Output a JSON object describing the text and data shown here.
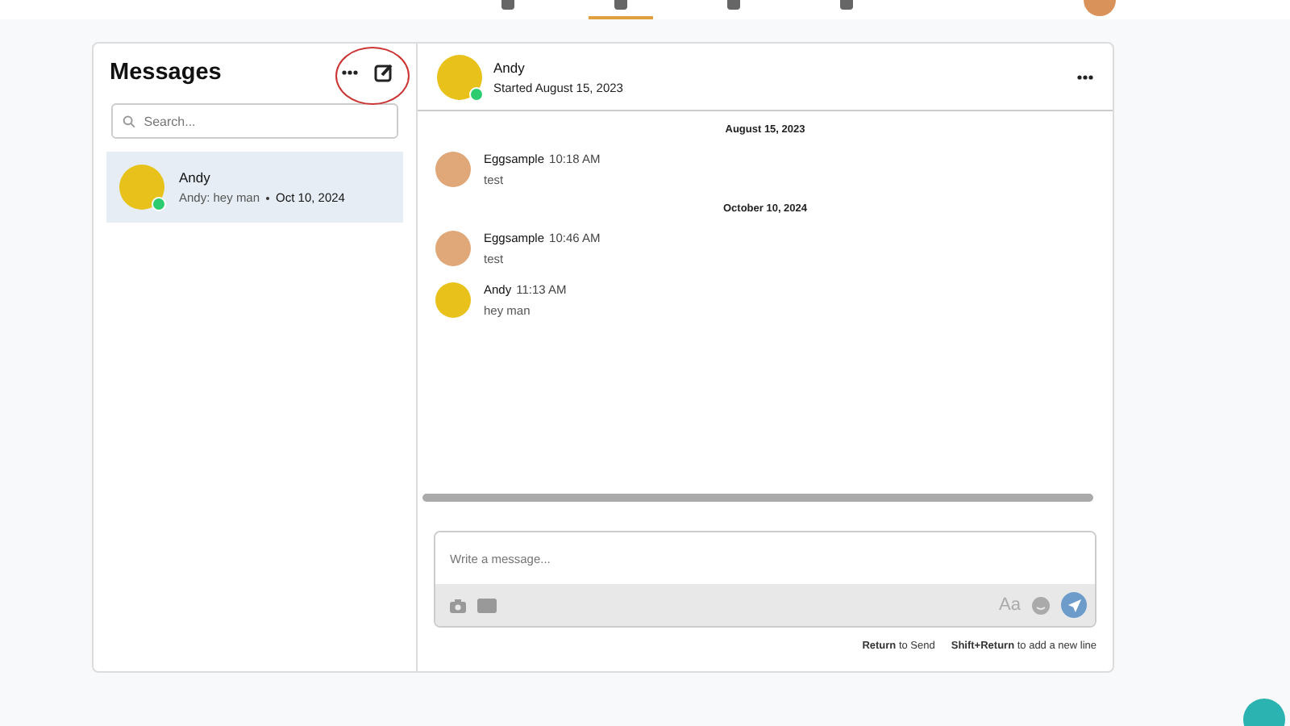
{
  "nav": {
    "tabs": [
      {
        "selected": false
      },
      {
        "selected": true
      },
      {
        "selected": false
      },
      {
        "selected": false
      }
    ]
  },
  "sidebar": {
    "title": "Messages",
    "search": {
      "placeholder": "Search..."
    },
    "conversations": [
      {
        "name": "Andy",
        "preview": "Andy: hey man",
        "date": "Oct 10, 2024",
        "selected": true,
        "online": true
      }
    ]
  },
  "conversation": {
    "name": "Andy",
    "subtitle": "Started August 15, 2023",
    "online": true,
    "items": [
      {
        "kind": "date",
        "text": "August 15, 2023"
      },
      {
        "kind": "message",
        "sender": "Eggsample",
        "color": "#e0a878",
        "time": "10:18 AM",
        "text": "test"
      },
      {
        "kind": "date",
        "text": "October 10, 2024"
      },
      {
        "kind": "message",
        "sender": "Eggsample",
        "color": "#e0a878",
        "time": "10:46 AM",
        "text": "test"
      },
      {
        "kind": "message",
        "sender": "Andy",
        "color": "#e8c21a",
        "time": "11:13 AM",
        "text": "hey man"
      }
    ],
    "composer": {
      "placeholder": "Write a message...",
      "format_label": "Aa"
    },
    "hints": [
      "**Return** to Send",
      "**Shift+Return** to add a new line"
    ]
  }
}
